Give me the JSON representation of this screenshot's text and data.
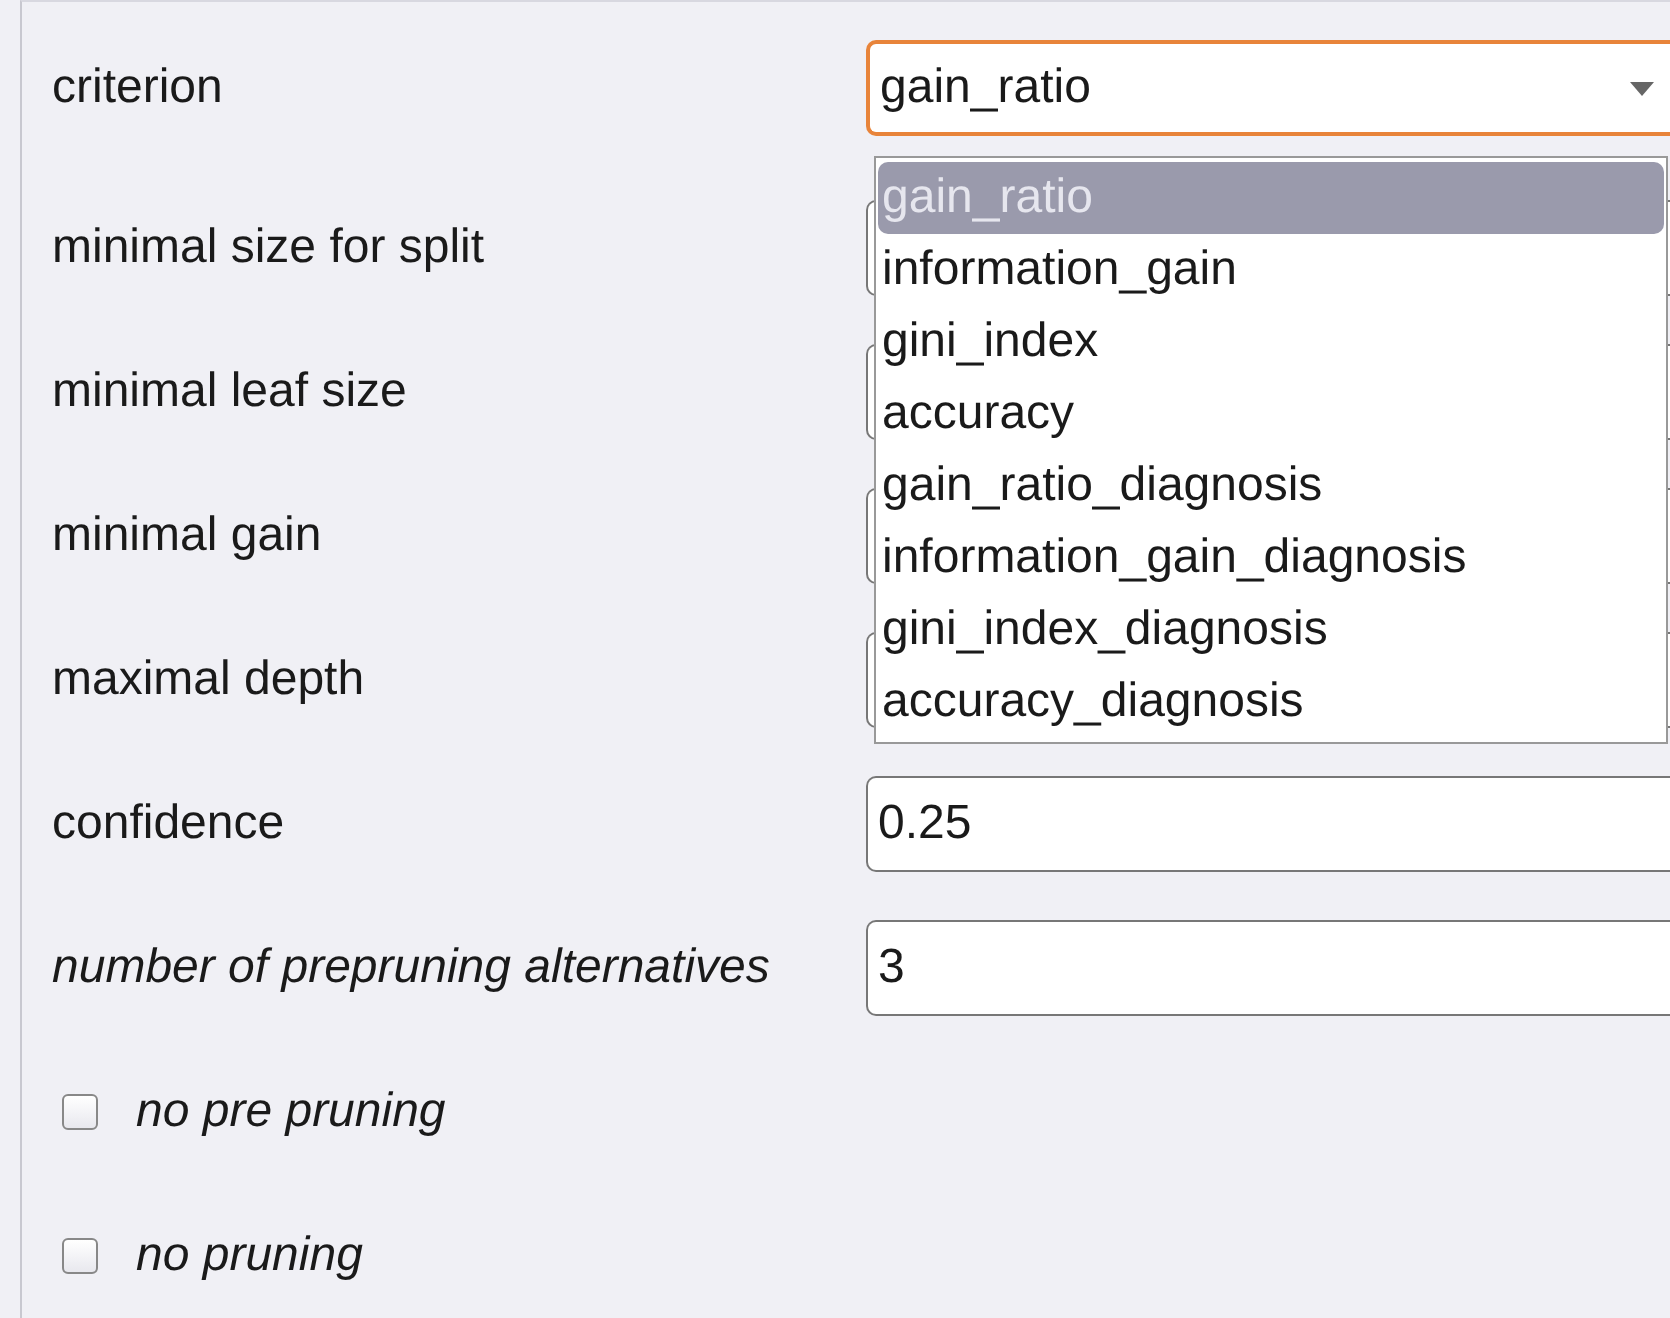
{
  "parameters": [
    {
      "kind": "dropdown",
      "label": "criterion",
      "expert": false,
      "value": "gain_ratio",
      "expanded": true,
      "options": [
        {
          "label": "gain_ratio",
          "selected": true
        },
        {
          "label": "information_gain",
          "selected": false
        },
        {
          "label": "gini_index",
          "selected": false
        },
        {
          "label": "accuracy",
          "selected": false
        },
        {
          "label": "gain_ratio_diagnosis",
          "selected": false
        },
        {
          "label": "information_gain_diagnosis",
          "selected": false
        },
        {
          "label": "gini_index_diagnosis",
          "selected": false
        },
        {
          "label": "accuracy_diagnosis",
          "selected": false
        }
      ]
    },
    {
      "kind": "number",
      "label": "minimal size for split",
      "expert": false
    },
    {
      "kind": "number",
      "label": "minimal leaf size",
      "expert": false
    },
    {
      "kind": "number",
      "label": "minimal gain",
      "expert": false
    },
    {
      "kind": "number",
      "label": "maximal depth",
      "expert": false
    },
    {
      "kind": "number",
      "label": "confidence",
      "expert": false,
      "value": "0.25"
    },
    {
      "kind": "number",
      "label": "number of prepruning alternatives",
      "expert": true,
      "value": "3"
    },
    {
      "kind": "checkbox",
      "label": "no pre pruning",
      "expert": true,
      "checked": false
    },
    {
      "kind": "checkbox",
      "label": "no pruning",
      "expert": true,
      "checked": false
    }
  ]
}
